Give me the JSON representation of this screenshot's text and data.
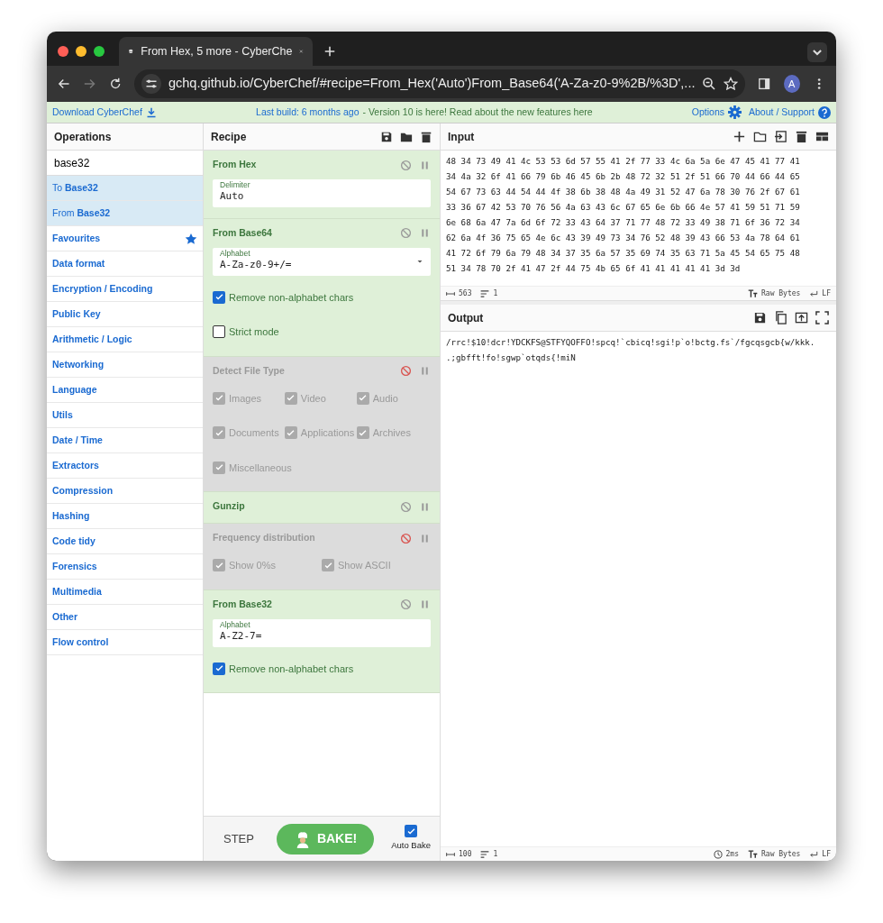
{
  "browser": {
    "tab_title": "From Hex, 5 more - CyberChe",
    "url": "gchq.github.io/CyberChef/#recipe=From_Hex('Auto')From_Base64('A-Za-z0-9%2B/%3D',...",
    "profile_initial": "A"
  },
  "banner": {
    "download": "Download CyberChef",
    "build": "Last build: 6 months ago",
    "message": "- Version 10 is here! Read about the new features here",
    "options": "Options",
    "about": "About / Support"
  },
  "operations": {
    "title": "Operations",
    "search": "base32",
    "results": [
      {
        "label": "To **Base32**"
      },
      {
        "label": "From **Base32**"
      }
    ],
    "categories": [
      {
        "label": "Favourites",
        "kind": "favourites"
      },
      {
        "label": "Data format",
        "kind": "category"
      },
      {
        "label": "Encryption / Encoding",
        "kind": "category"
      },
      {
        "label": "Public Key",
        "kind": "category"
      },
      {
        "label": "Arithmetic / Logic",
        "kind": "category"
      },
      {
        "label": "Networking",
        "kind": "category"
      },
      {
        "label": "Language",
        "kind": "category"
      },
      {
        "label": "Utils",
        "kind": "category"
      },
      {
        "label": "Date / Time",
        "kind": "category"
      },
      {
        "label": "Extractors",
        "kind": "category"
      },
      {
        "label": "Compression",
        "kind": "category"
      },
      {
        "label": "Hashing",
        "kind": "category"
      },
      {
        "label": "Code tidy",
        "kind": "category"
      },
      {
        "label": "Forensics",
        "kind": "category"
      },
      {
        "label": "Multimedia",
        "kind": "category"
      },
      {
        "label": "Other",
        "kind": "category"
      },
      {
        "label": "Flow control",
        "kind": "category"
      }
    ]
  },
  "recipe": {
    "title": "Recipe",
    "ops": [
      {
        "name": "From Hex",
        "disabled": false,
        "args": [
          {
            "kind": "text",
            "label": "Delimiter",
            "value": "Auto"
          }
        ]
      },
      {
        "name": "From Base64",
        "disabled": false,
        "args": [
          {
            "kind": "select",
            "label": "Alphabet",
            "value": "A-Za-z0-9+/="
          },
          {
            "kind": "checkbox-row",
            "label": "Remove non-alphabet chars",
            "checked": true
          },
          {
            "kind": "checkbox-row",
            "label": "Strict mode",
            "checked": false
          }
        ]
      },
      {
        "name": "Detect File Type",
        "disabled": true,
        "args": [
          {
            "kind": "checkbox",
            "label": "Images",
            "checked": true
          },
          {
            "kind": "checkbox",
            "label": "Video",
            "checked": true
          },
          {
            "kind": "checkbox",
            "label": "Audio",
            "checked": true
          },
          {
            "kind": "checkbox",
            "label": "Documents",
            "checked": true
          },
          {
            "kind": "checkbox",
            "label": "Applications",
            "checked": true
          },
          {
            "kind": "checkbox",
            "label": "Archives",
            "checked": true
          },
          {
            "kind": "checkbox",
            "label": "Miscellaneous",
            "checked": true
          }
        ]
      },
      {
        "name": "Gunzip",
        "disabled": false
      },
      {
        "name": "Frequency distribution",
        "disabled": true,
        "args": [
          {
            "kind": "checkbox-half",
            "label": "Show 0%s",
            "checked": true
          },
          {
            "kind": "checkbox-half",
            "label": "Show ASCII",
            "checked": true
          }
        ]
      },
      {
        "name": "From Base32",
        "disabled": false,
        "args": [
          {
            "kind": "text",
            "label": "Alphabet",
            "value": "A-Z2-7="
          },
          {
            "kind": "checkbox-row",
            "label": "Remove non-alphabet chars",
            "checked": true
          }
        ]
      }
    ],
    "step": "STEP",
    "bake": "BAKE!",
    "auto_bake": {
      "label": "Auto Bake",
      "checked": true
    }
  },
  "input": {
    "title": "Input",
    "lines": [
      "48 34 73 49 41 4c 53 53 6d 57 55 41 2f 77 33 4c 6a 5a 6e 47 45 41 77 41",
      "34 4a 32 6f 41 66 79 6b 46 45 6b 2b 48 72 32 51 2f 51 66 70 44 66 44 65",
      "54 67 73 63 44 54 44 4f 38 6b 38 48 4a 49 31 52 47 6a 78 30 76 2f 67 61",
      "33 36 67 42 53 70 76 56 4a 63 43 6c 67 65 6e 6b 66 4e 57 41 59 51 71 59",
      "6e 68 6a 47 7a 6d 6f 72 33 43 64 37 71 77 48 72 33 49 38 71 6f 36 72 34",
      "62 6a 4f 36 75 65 4e 6c 43 39 49 73 34 76 52 48 39 43 66 53 4a 78 64 61",
      "41 72 6f 79 6a 79 48 34 37 35 6a 57 35 69 74 35 63 71 5a 45 54 65 75 48",
      "51 34 78 70 2f 41 47 2f 44 75 4b 65 6f 41 41 41 41 41 3d 3d"
    ],
    "length": "563",
    "line_count": "1",
    "encoding": "Raw Bytes",
    "eol": "LF"
  },
  "output": {
    "title": "Output",
    "lines": [
      "/rrc!$10!dcr!YDCKFS@STFYQOFFO!spcq!`cbicq!sgi!p`o!bctg.fs`/fgcqsgcb{w/kkk.",
      ".;gbfft!fo!sgwp`otqds{!miN"
    ],
    "length": "100",
    "line_count": "1",
    "time": "2ms",
    "encoding": "Raw Bytes",
    "eol": "LF"
  }
}
